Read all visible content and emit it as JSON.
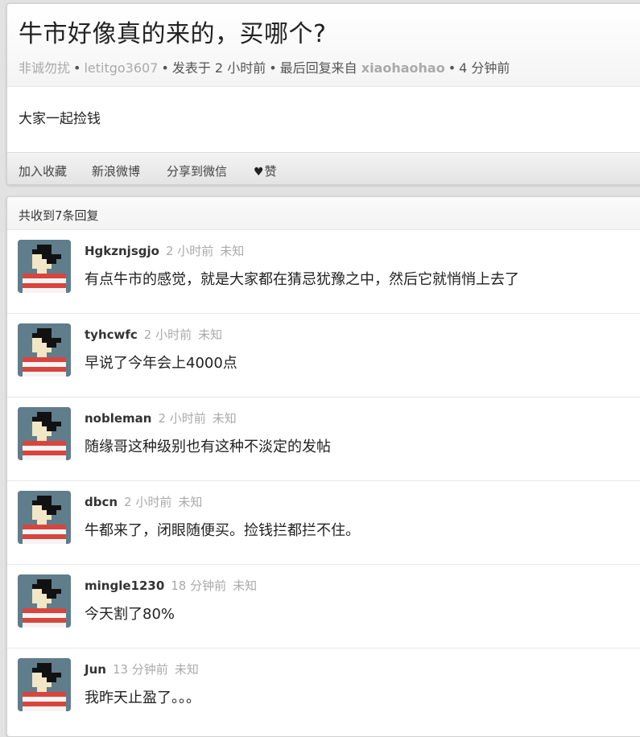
{
  "topic": {
    "title": "牛市好像真的来的，买哪个?",
    "node": "非诚勿扰",
    "author": "letitgo3607",
    "posted": "发表于 2 小时前",
    "last_reply_prefix": "最后回复来自",
    "last_reply_user": "xiaohaohao",
    "last_reply_time": "4 分钟前",
    "body": "大家一起捡钱",
    "actions": {
      "favorite": "加入收藏",
      "weibo": "新浪微博",
      "wechat": "分享到微信",
      "like": "赞"
    }
  },
  "replies": {
    "count_label": "共收到7条回复",
    "items": [
      {
        "user": "Hgkznjsgjo",
        "time": "2 小时前",
        "location": "未知",
        "content": "有点牛市的感觉，就是大家都在猜忌犹豫之中，然后它就悄悄上去了"
      },
      {
        "user": "tyhcwfc",
        "time": "2 小时前",
        "location": "未知",
        "content": "早说了今年会上4000点"
      },
      {
        "user": "nobleman",
        "time": "2 小时前",
        "location": "未知",
        "content": "随缘哥这种级别也有这种不淡定的发帖"
      },
      {
        "user": "dbcn",
        "time": "2 小时前",
        "location": "未知",
        "content": "牛都来了，闭眼随便买。捡钱拦都拦不住。"
      },
      {
        "user": "mingle1230",
        "time": "18 分钟前",
        "location": "未知",
        "content": "今天割了80%"
      },
      {
        "user": "Jun",
        "time": "13 分钟前",
        "location": "未知",
        "content": "我昨天止盈了。。。"
      }
    ]
  },
  "colors": {
    "avatar_bg": "#607d8b",
    "avatar_stripe": "#d9453d",
    "page_bg": "#e2e2e2"
  },
  "icons": {
    "like": "heart-icon",
    "avatar": "pixel-avatar-icon"
  }
}
